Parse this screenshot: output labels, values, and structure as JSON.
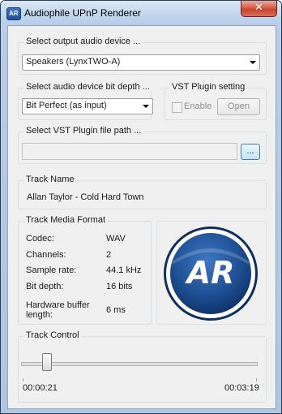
{
  "window": {
    "title": "Audiophile UPnP Renderer",
    "app_icon_text": "AR",
    "close_symbol": "✕"
  },
  "output_device": {
    "group_label": "Select output audio device ...",
    "selected": "Speakers (LynxTWO-A)"
  },
  "bit_depth": {
    "group_label": "Select audio device bit depth ...",
    "selected": "Bit Perfect (as input)"
  },
  "vst_setting": {
    "group_label": "VST Plugin setting",
    "enable_label": "Enable",
    "enable_checked": false,
    "open_label": "Open"
  },
  "vst_path": {
    "group_label": "Select VST Plugin file path ...",
    "value": "",
    "browse_label": "..."
  },
  "track_name": {
    "group_label": "Track Name",
    "value": "Allan Taylor - Cold Hard Town"
  },
  "media_format": {
    "group_label": "Track Media Format",
    "rows": [
      {
        "label": "Codec:",
        "value": "WAV"
      },
      {
        "label": "Channels:",
        "value": "2"
      },
      {
        "label": "Sample rate:",
        "value": "44.1 kHz"
      },
      {
        "label": "Bit depth:",
        "value": "16 bits"
      },
      {
        "label": "Hardware buffer length:",
        "value": "6 ms"
      }
    ]
  },
  "logo": {
    "text": "AR",
    "icon": "ar-logo-icon",
    "colors": {
      "ring": "#ffffff",
      "disc": "#1d4f93",
      "disc_dark": "#0e2f63"
    }
  },
  "track_control": {
    "group_label": "Track Control",
    "elapsed": "00:00:21",
    "total": "00:03:19",
    "position_fraction": 0.105
  }
}
